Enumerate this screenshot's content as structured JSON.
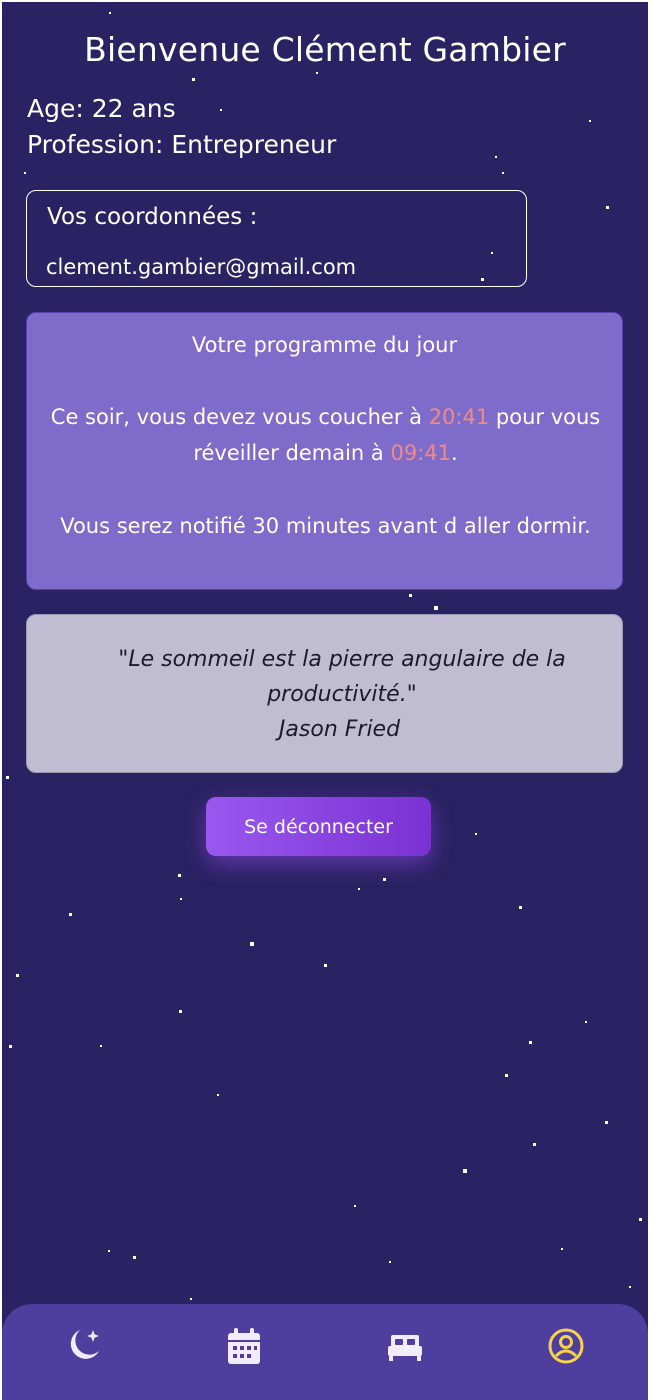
{
  "header": {
    "title": "Bienvenue Clément Gambier"
  },
  "profile": {
    "age_line": "Age: 22 ans",
    "profession_line": "Profession: Entrepreneur"
  },
  "contact": {
    "label": "Vos coordonnées :",
    "email": "clement.gambier@gmail.com"
  },
  "program": {
    "heading": "Votre programme du jour",
    "sleep_prefix": "Ce soir, vous devez vous coucher à ",
    "bed_time": "20:41",
    "sleep_middle": " pour vous réveiller demain à ",
    "wake_time": "09:41",
    "sleep_suffix": ".",
    "notification": "Vous serez notifié 30 minutes avant d aller dormir."
  },
  "quote": {
    "text": "\"Le sommeil est la pierre angulaire de la productivité.\"",
    "author": "Jason Fried"
  },
  "actions": {
    "logout_label": "Se déconnecter"
  },
  "tabbar": {
    "tabs": [
      {
        "icon": "moon-stars-icon"
      },
      {
        "icon": "calendar-icon"
      },
      {
        "icon": "bed-icon"
      },
      {
        "icon": "user-circle-icon",
        "active": true
      }
    ]
  },
  "colors": {
    "background": "#2a2262",
    "program_card": "#7e6ccb",
    "quote_card": "#c0bcd2",
    "time_highlight": "#f08a84",
    "button_gradient_start": "#9a58ef",
    "button_gradient_end": "#7a32d2",
    "tabbar": "#4e3e9e",
    "active_tab": "#f7d24a"
  }
}
